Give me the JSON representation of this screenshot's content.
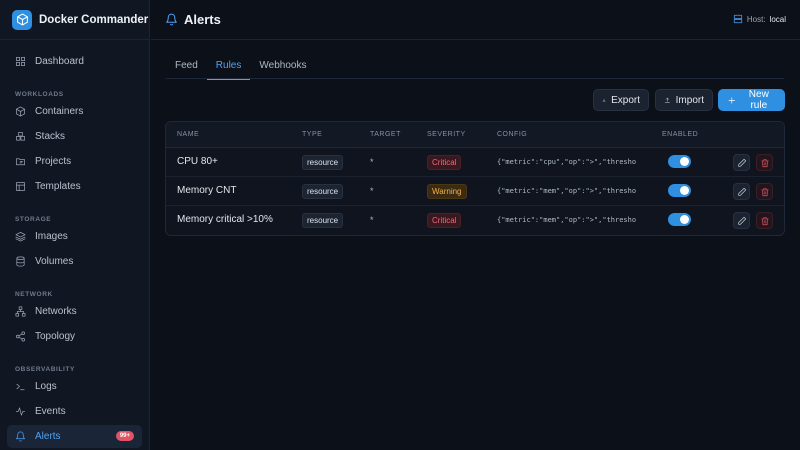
{
  "app": {
    "title": "Docker Commander"
  },
  "sidebar": {
    "dashboard": "Dashboard",
    "sections": {
      "workloads": "WORKLOADS",
      "storage": "STORAGE",
      "network": "NETWORK",
      "observability": "OBSERVABILITY"
    },
    "items": {
      "containers": "Containers",
      "stacks": "Stacks",
      "projects": "Projects",
      "templates": "Templates",
      "images": "Images",
      "volumes": "Volumes",
      "networks": "Networks",
      "topology": "Topology",
      "logs": "Logs",
      "events": "Events",
      "alerts": "Alerts"
    },
    "alerts_badge": "99+"
  },
  "header": {
    "title": "Alerts",
    "host_label": "Host:",
    "host_value": "local"
  },
  "tabs": [
    "Feed",
    "Rules",
    "Webhooks"
  ],
  "active_tab": "Rules",
  "toolbar": {
    "export": "Export",
    "import": "Import",
    "new_rule": "New rule"
  },
  "table": {
    "columns": [
      "NAME",
      "TYPE",
      "TARGET",
      "SEVERITY",
      "CONFIG",
      "ENABLED"
    ],
    "rows": [
      {
        "name": "CPU 80+",
        "type": "resource",
        "target": "*",
        "severity": "Critical",
        "config": "{\"metric\":\"cpu\",\"op\":\">\",\"thresho",
        "enabled": true
      },
      {
        "name": "Memory CNT",
        "type": "resource",
        "target": "*",
        "severity": "Warning",
        "config": "{\"metric\":\"mem\",\"op\":\">\",\"thresho",
        "enabled": true
      },
      {
        "name": "Memory critical >10%",
        "type": "resource",
        "target": "*",
        "severity": "Critical",
        "config": "{\"metric\":\"mem\",\"op\":\">\",\"thresho",
        "enabled": true
      }
    ]
  },
  "colors": {
    "accent": "#2f8fe0",
    "critical": "#ee6a7b",
    "warning": "#f2b14a",
    "background": "#0c1019"
  },
  "icons": {
    "brand": "cube-icon",
    "dashboard": "grid-icon",
    "alerts": "bell-icon",
    "export": "download-icon",
    "import": "upload-icon",
    "new": "plus-icon",
    "edit": "pencil-icon",
    "delete": "trash-icon",
    "host": "server-icon"
  }
}
